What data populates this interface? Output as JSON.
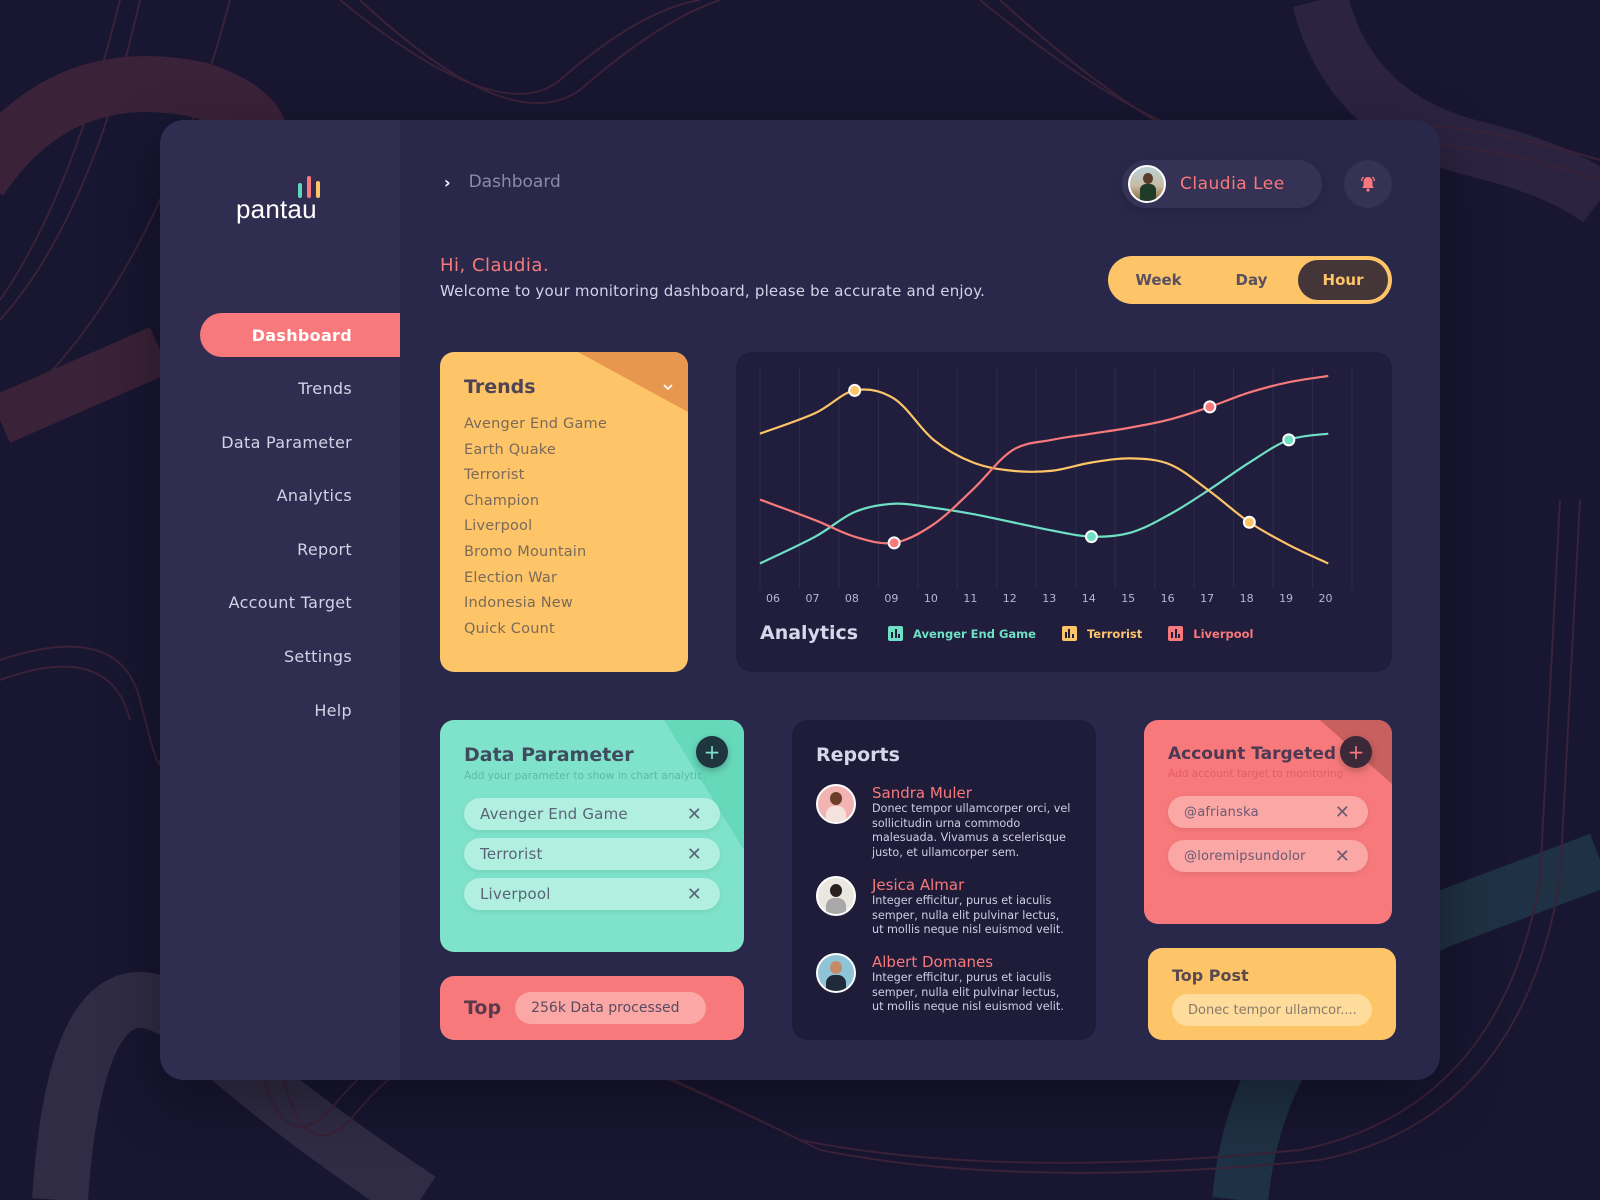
{
  "brand": {
    "name": "pantau",
    "bar_colors": [
      "#5fd6b9",
      "#f7797b",
      "#fdc468"
    ]
  },
  "colors": {
    "coral": "#f7797b",
    "yellow": "#fdc468",
    "teal": "#7fe3cb",
    "bg": "#181631",
    "panel": "#29284a",
    "sidebar": "#302d50",
    "card_dark": "#201e3c"
  },
  "sidebar": {
    "items": [
      {
        "label": "Dashboard",
        "active": true
      },
      {
        "label": "Trends"
      },
      {
        "label": "Data Parameter"
      },
      {
        "label": "Analytics"
      },
      {
        "label": "Report"
      },
      {
        "label": "Account Target"
      },
      {
        "label": "Settings"
      },
      {
        "label": "Help"
      }
    ]
  },
  "header": {
    "breadcrumb_icon": "chevron-right-icon",
    "breadcrumb": "Dashboard",
    "user_name": "Claudia Lee",
    "notification_icon": "bell-icon"
  },
  "greeting": {
    "title": "Hi, Claudia.",
    "subtitle": "Welcome to your monitoring dashboard, please be accurate and enjoy."
  },
  "range": {
    "options": [
      "Week",
      "Day",
      "Hour"
    ],
    "selected": "Hour"
  },
  "trends": {
    "title": "Trends",
    "toggle_icon": "chevron-down-icon",
    "items": [
      "Avenger End Game",
      "Earth Quake",
      "Terrorist",
      "Champion",
      "Liverpool",
      "Bromo Mountain",
      "Election War",
      "Indonesia New",
      "Quick Count"
    ]
  },
  "analytics": {
    "title": "Analytics"
  },
  "chart_data": {
    "type": "line",
    "title": "Analytics",
    "xlabel": "",
    "ylabel": "",
    "x": [
      "06",
      "07",
      "08",
      "09",
      "10",
      "11",
      "12",
      "13",
      "14",
      "15",
      "16",
      "17",
      "18",
      "19",
      "20"
    ],
    "ylim": [
      0,
      100
    ],
    "grid": "vertical",
    "legend": "bottom-left",
    "series": [
      {
        "name": "Avenger End Game",
        "color": "#6fe0c5",
        "values": [
          9,
          22,
          34,
          38,
          36,
          33,
          29,
          25,
          22,
          24,
          33,
          45,
          58,
          69,
          72
        ],
        "highlight_index": [
          8,
          13
        ]
      },
      {
        "name": "Terrorist",
        "color": "#fdc468",
        "values": [
          72,
          82,
          93,
          89,
          69,
          58,
          54,
          54,
          58,
          60,
          57,
          44,
          29,
          18,
          9
        ],
        "highlight_index": [
          2,
          12
        ]
      },
      {
        "name": "Liverpool",
        "color": "#f7797b",
        "values": [
          40,
          30,
          22,
          19,
          28,
          45,
          64,
          69,
          72,
          75,
          79,
          85,
          92,
          97,
          100
        ],
        "highlight_index": [
          3,
          11
        ]
      }
    ]
  },
  "data_parameter": {
    "title": "Data Parameter",
    "subtitle": "Add your parameter to show in chart analytic.",
    "add_icon": "plus-icon",
    "items": [
      "Avenger End Game",
      "Terrorist",
      "Liverpool"
    ],
    "remove_icon": "close-icon"
  },
  "top": {
    "label": "Top",
    "value": "256k Data processed"
  },
  "reports": {
    "title": "Reports",
    "items": [
      {
        "name": "Sandra Muler",
        "text": "Donec tempor ullamcorper orci, vel sollicitudin urna commodo malesuada. Vivamus a scelerisque justo, et ullamcorper sem.",
        "avatar_bg": "#f2b3b3",
        "head": "#6b3e2a",
        "body": "#f4e2dc"
      },
      {
        "name": "Jesica Almar",
        "text": "Integer efficitur, purus et iaculis semper, nulla elit pulvinar lectus, ut mollis neque nisl euismod velit.",
        "avatar_bg": "#eae6e0",
        "head": "#2a2020",
        "body": "#a8a8a8"
      },
      {
        "name": "Albert Domanes",
        "text": "Integer efficitur, purus et iaculis semper, nulla elit pulvinar lectus, ut mollis neque nisl euismod velit.",
        "avatar_bg": "#8fc3d6",
        "head": "#c48a6a",
        "body": "#1f2a3a"
      }
    ]
  },
  "account_targeted": {
    "title": "Account Targeted",
    "subtitle": "Add account target to monitoring",
    "add_icon": "plus-icon",
    "items": [
      "@afrianska",
      "@loremipsundolor"
    ],
    "remove_icon": "close-icon"
  },
  "top_post": {
    "title": "Top Post",
    "value": "Donec tempor ullamcor...."
  }
}
